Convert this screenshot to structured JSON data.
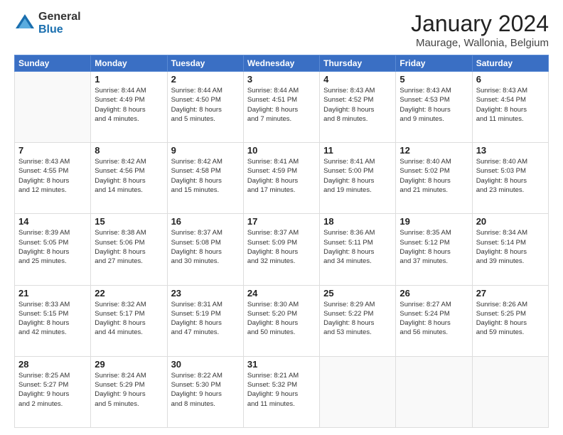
{
  "header": {
    "logo_general": "General",
    "logo_blue": "Blue",
    "month": "January 2024",
    "location": "Maurage, Wallonia, Belgium"
  },
  "weekdays": [
    "Sunday",
    "Monday",
    "Tuesday",
    "Wednesday",
    "Thursday",
    "Friday",
    "Saturday"
  ],
  "weeks": [
    [
      {
        "day": "",
        "info": ""
      },
      {
        "day": "1",
        "info": "Sunrise: 8:44 AM\nSunset: 4:49 PM\nDaylight: 8 hours\nand 4 minutes."
      },
      {
        "day": "2",
        "info": "Sunrise: 8:44 AM\nSunset: 4:50 PM\nDaylight: 8 hours\nand 5 minutes."
      },
      {
        "day": "3",
        "info": "Sunrise: 8:44 AM\nSunset: 4:51 PM\nDaylight: 8 hours\nand 7 minutes."
      },
      {
        "day": "4",
        "info": "Sunrise: 8:43 AM\nSunset: 4:52 PM\nDaylight: 8 hours\nand 8 minutes."
      },
      {
        "day": "5",
        "info": "Sunrise: 8:43 AM\nSunset: 4:53 PM\nDaylight: 8 hours\nand 9 minutes."
      },
      {
        "day": "6",
        "info": "Sunrise: 8:43 AM\nSunset: 4:54 PM\nDaylight: 8 hours\nand 11 minutes."
      }
    ],
    [
      {
        "day": "7",
        "info": "Sunrise: 8:43 AM\nSunset: 4:55 PM\nDaylight: 8 hours\nand 12 minutes."
      },
      {
        "day": "8",
        "info": "Sunrise: 8:42 AM\nSunset: 4:56 PM\nDaylight: 8 hours\nand 14 minutes."
      },
      {
        "day": "9",
        "info": "Sunrise: 8:42 AM\nSunset: 4:58 PM\nDaylight: 8 hours\nand 15 minutes."
      },
      {
        "day": "10",
        "info": "Sunrise: 8:41 AM\nSunset: 4:59 PM\nDaylight: 8 hours\nand 17 minutes."
      },
      {
        "day": "11",
        "info": "Sunrise: 8:41 AM\nSunset: 5:00 PM\nDaylight: 8 hours\nand 19 minutes."
      },
      {
        "day": "12",
        "info": "Sunrise: 8:40 AM\nSunset: 5:02 PM\nDaylight: 8 hours\nand 21 minutes."
      },
      {
        "day": "13",
        "info": "Sunrise: 8:40 AM\nSunset: 5:03 PM\nDaylight: 8 hours\nand 23 minutes."
      }
    ],
    [
      {
        "day": "14",
        "info": "Sunrise: 8:39 AM\nSunset: 5:05 PM\nDaylight: 8 hours\nand 25 minutes."
      },
      {
        "day": "15",
        "info": "Sunrise: 8:38 AM\nSunset: 5:06 PM\nDaylight: 8 hours\nand 27 minutes."
      },
      {
        "day": "16",
        "info": "Sunrise: 8:37 AM\nSunset: 5:08 PM\nDaylight: 8 hours\nand 30 minutes."
      },
      {
        "day": "17",
        "info": "Sunrise: 8:37 AM\nSunset: 5:09 PM\nDaylight: 8 hours\nand 32 minutes."
      },
      {
        "day": "18",
        "info": "Sunrise: 8:36 AM\nSunset: 5:11 PM\nDaylight: 8 hours\nand 34 minutes."
      },
      {
        "day": "19",
        "info": "Sunrise: 8:35 AM\nSunset: 5:12 PM\nDaylight: 8 hours\nand 37 minutes."
      },
      {
        "day": "20",
        "info": "Sunrise: 8:34 AM\nSunset: 5:14 PM\nDaylight: 8 hours\nand 39 minutes."
      }
    ],
    [
      {
        "day": "21",
        "info": "Sunrise: 8:33 AM\nSunset: 5:15 PM\nDaylight: 8 hours\nand 42 minutes."
      },
      {
        "day": "22",
        "info": "Sunrise: 8:32 AM\nSunset: 5:17 PM\nDaylight: 8 hours\nand 44 minutes."
      },
      {
        "day": "23",
        "info": "Sunrise: 8:31 AM\nSunset: 5:19 PM\nDaylight: 8 hours\nand 47 minutes."
      },
      {
        "day": "24",
        "info": "Sunrise: 8:30 AM\nSunset: 5:20 PM\nDaylight: 8 hours\nand 50 minutes."
      },
      {
        "day": "25",
        "info": "Sunrise: 8:29 AM\nSunset: 5:22 PM\nDaylight: 8 hours\nand 53 minutes."
      },
      {
        "day": "26",
        "info": "Sunrise: 8:27 AM\nSunset: 5:24 PM\nDaylight: 8 hours\nand 56 minutes."
      },
      {
        "day": "27",
        "info": "Sunrise: 8:26 AM\nSunset: 5:25 PM\nDaylight: 8 hours\nand 59 minutes."
      }
    ],
    [
      {
        "day": "28",
        "info": "Sunrise: 8:25 AM\nSunset: 5:27 PM\nDaylight: 9 hours\nand 2 minutes."
      },
      {
        "day": "29",
        "info": "Sunrise: 8:24 AM\nSunset: 5:29 PM\nDaylight: 9 hours\nand 5 minutes."
      },
      {
        "day": "30",
        "info": "Sunrise: 8:22 AM\nSunset: 5:30 PM\nDaylight: 9 hours\nand 8 minutes."
      },
      {
        "day": "31",
        "info": "Sunrise: 8:21 AM\nSunset: 5:32 PM\nDaylight: 9 hours\nand 11 minutes."
      },
      {
        "day": "",
        "info": ""
      },
      {
        "day": "",
        "info": ""
      },
      {
        "day": "",
        "info": ""
      }
    ]
  ]
}
